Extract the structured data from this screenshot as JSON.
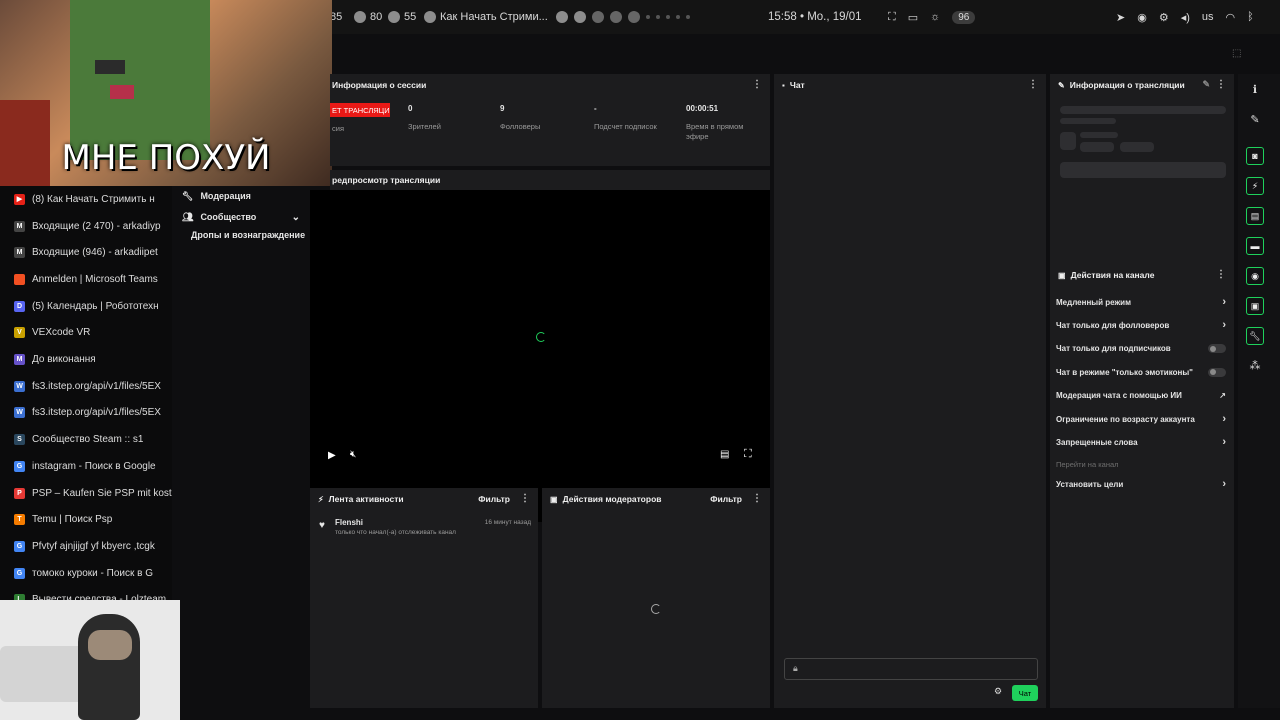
{
  "topbar": {
    "num1": "85",
    "num2": "80",
    "num3": "55",
    "tab_title": "Как Начать Стрими...",
    "clock": "15:58 • Mo., 19/01",
    "battery": "96",
    "lang": "us"
  },
  "sidebar": {
    "tabs": [
      {
        "label": "(8) Как Начать Стримить н",
        "icon": "youtube-icon",
        "color": "#e62117",
        "glyph": "▶"
      },
      {
        "label": "Входящие (2 470) - arkadiyp",
        "icon": "gmail-icon",
        "color": "#444",
        "glyph": "M"
      },
      {
        "label": "Входящие (946) - arkadiipet",
        "icon": "gmail-icon",
        "color": "#444",
        "glyph": "M"
      },
      {
        "label": "Anmelden | Microsoft Teams",
        "icon": "microsoft-icon",
        "color": "#f25022",
        "glyph": ""
      },
      {
        "label": "(5) Календарь | Робототехн",
        "icon": "discord-icon",
        "color": "#5865f2",
        "glyph": "D"
      },
      {
        "label": "VEXcode VR",
        "icon": "vex-icon",
        "color": "#c8a000",
        "glyph": "V"
      },
      {
        "label": "До виконання",
        "icon": "app-icon",
        "color": "#6652c9",
        "glyph": "M"
      },
      {
        "label": "fs3.itstep.org/api/v1/files/5EX",
        "icon": "file-icon",
        "color": "#3b6fd1",
        "glyph": "W"
      },
      {
        "label": "fs3.itstep.org/api/v1/files/5EX",
        "icon": "file-icon",
        "color": "#3b6fd1",
        "glyph": "W"
      },
      {
        "label": "Сообщество Steam :: s1",
        "icon": "steam-icon",
        "color": "#2a475e",
        "glyph": "S"
      },
      {
        "label": "instagram - Поиск в Google",
        "icon": "google-icon",
        "color": "#4285f4",
        "glyph": "G"
      },
      {
        "label": "PSP – Kaufen Sie PSP mit kost",
        "icon": "shop-icon",
        "color": "#e53935",
        "glyph": "P"
      },
      {
        "label": "Temu | Поиск Psp",
        "icon": "temu-icon",
        "color": "#f57c00",
        "glyph": "T"
      },
      {
        "label": "Pfvtyf ajnjijgf yf kbyerc ,tcgk",
        "icon": "google-icon",
        "color": "#4285f4",
        "glyph": "G"
      },
      {
        "label": "томоко куроки - Поиск в G",
        "icon": "google-icon",
        "color": "#4285f4",
        "glyph": "G"
      },
      {
        "label": "Вывести средства - Lolzteam",
        "icon": "lolz-icon",
        "color": "#2e7d32",
        "glyph": "L"
      }
    ]
  },
  "nav": {
    "moderation": "Модерация",
    "community": "Сообщество",
    "drops": "Дропы и вознаграждение"
  },
  "overlay": {
    "caption": "МНЕ ПОХУЙ"
  },
  "session": {
    "title": "Информация о сессии",
    "live_badge": "ЭФИР: ЕТ ТРАНСЛЯЦИЯ",
    "live_badge_visible": "ЕТ ТРАНСЛЯЦИЯ",
    "session_sub": "сия",
    "stats": [
      {
        "value": "0",
        "label": "Зрителей"
      },
      {
        "value": "9",
        "label": "Фолловеры"
      },
      {
        "value": "-",
        "label": "Подсчет подписок"
      },
      {
        "value": "00:00:51",
        "label": "Время в прямом эфире"
      }
    ]
  },
  "preview": {
    "title": "редпросмотр трансляции"
  },
  "activity": {
    "title": "Лента активности",
    "filter": "Фильтр",
    "user": "Flenshi",
    "time": "16 минут назад",
    "text": "только что начал(-а) отслеживать канал"
  },
  "modactions": {
    "title": "Действия модераторов",
    "filter": "Фильтр"
  },
  "chat": {
    "title": "Чат",
    "send": "Чат"
  },
  "streaminfo": {
    "title": "Информация о трансляции"
  },
  "channel": {
    "title": "Действия на канале",
    "rows": [
      {
        "label": "Медленный режим",
        "kind": "chev"
      },
      {
        "label": "Чат только для фолловеров",
        "kind": "chev"
      },
      {
        "label": "Чат только для подписчиков",
        "kind": "toggle"
      },
      {
        "label": "Чат в режиме \"только эмотиконы\"",
        "kind": "toggle"
      },
      {
        "label": "Модерация чата с помощью ИИ",
        "kind": "ext"
      },
      {
        "label": "Ограничение по возрасту аккаунта",
        "kind": "chev"
      },
      {
        "label": "Запрещенные слова",
        "kind": "chev"
      }
    ],
    "goto": "Перейти на канал",
    "goals": "Установить цели"
  },
  "colors": {
    "accent": "#1fd15c",
    "live": "#e91916",
    "panel": "#1c1c1e"
  }
}
